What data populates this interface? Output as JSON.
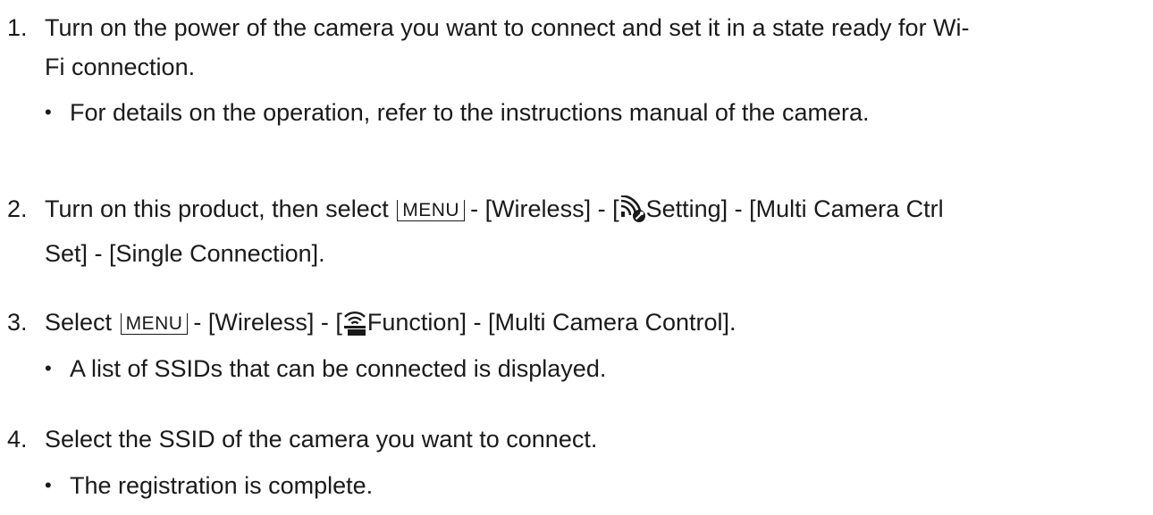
{
  "steps": [
    {
      "num": "1.",
      "line1": "Turn on the power of the camera you want to connect and set it in a state ready for Wi-",
      "line2": "Fi connection.",
      "bullets": [
        "For details on the operation, refer to the instructions manual of the camera."
      ]
    },
    {
      "num": "2.",
      "prefix": "Turn on this product, then select",
      "menu_key": "MENU",
      "mid": "- [Wireless] - [",
      "icon": "wifi-setting-icon",
      "after_icon": "Setting] - [Multi Camera Ctrl",
      "line2": "Set] - [Single Connection]."
    },
    {
      "num": "3.",
      "prefix": "Select",
      "menu_key": "MENU",
      "mid": "- [Wireless] - [",
      "icon": "wifi-function-icon",
      "after_icon": "Function] - [Multi Camera Control].",
      "bullets": [
        "A list of SSIDs that can be connected is displayed."
      ]
    },
    {
      "num": "4.",
      "text": "Select the SSID of the camera you want to connect.",
      "bullets": [
        "The registration is complete."
      ]
    }
  ],
  "bullet_symbol": "•",
  "text_color": "#1a1a1a"
}
